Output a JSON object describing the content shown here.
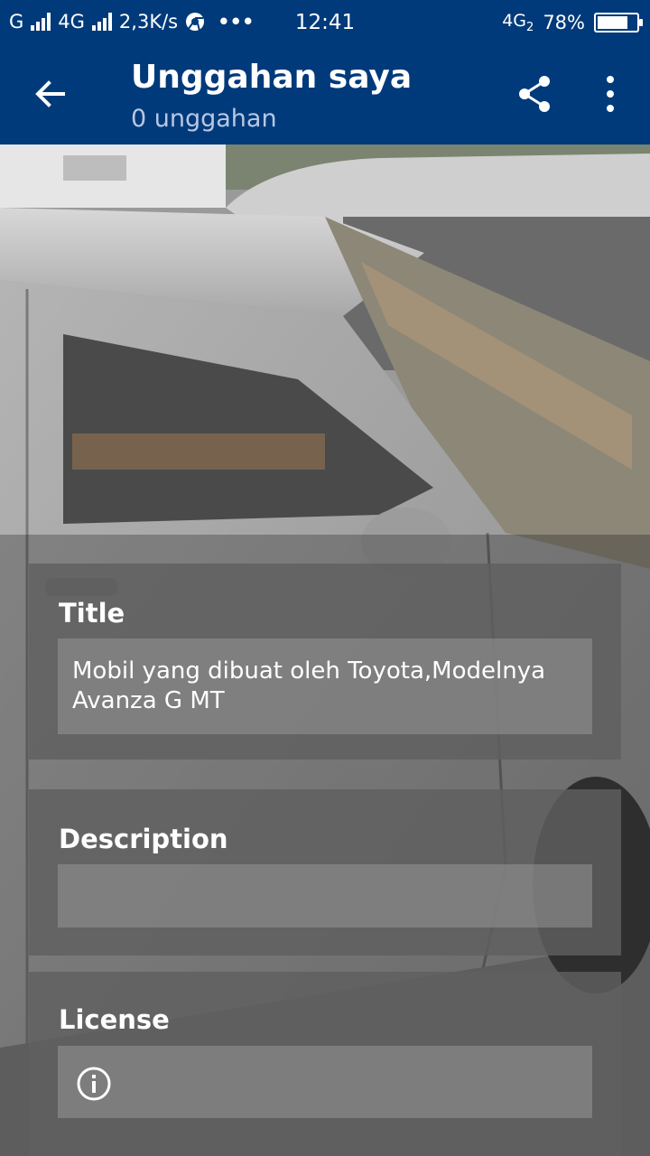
{
  "status_bar": {
    "carrier1": "G",
    "carrier2": "4G",
    "speed": "2,3K/s",
    "more": "•••",
    "time": "12:41",
    "network": "4G",
    "network_sub": "2",
    "battery": "78%",
    "battery_level": 0.78
  },
  "app_bar": {
    "title": "Unggahan saya",
    "subtitle": "0 unggahan",
    "icons": [
      "arrow-back-icon",
      "share-icon",
      "more-vert-icon"
    ]
  },
  "form": {
    "title_label": "Title",
    "title_value": "Mobil yang dibuat oleh Toyota,Modelnya Avanza G MT",
    "description_label": "Description",
    "description_value": "",
    "license_label": "License"
  },
  "colors": {
    "app_bar": "#003a7a",
    "card": "#5f5f5f"
  }
}
